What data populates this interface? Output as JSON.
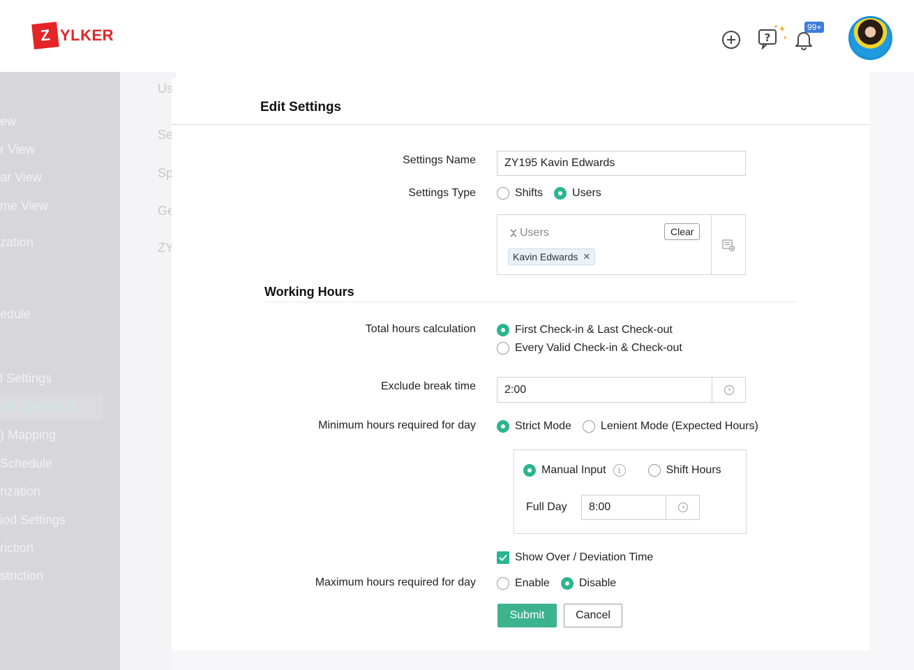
{
  "brand": {
    "logo_letter": "Z",
    "logo_rest": "YLKER",
    "accent": "#e42527"
  },
  "header": {
    "notification_badge": "99+",
    "icons": [
      "plus-circle-icon",
      "help-chat-icon",
      "bell-icon"
    ]
  },
  "sidebar": {
    "items": [
      {
        "label": "ew"
      },
      {
        "label": "r View"
      },
      {
        "label": "ar View"
      },
      {
        "label": "me View"
      },
      {
        "label": "zation"
      },
      {
        "label": "edule"
      },
      {
        "label": "l Settings"
      },
      {
        "label": "hift Specific S..."
      },
      {
        "label": ") Mapping"
      },
      {
        "label": " Schedule"
      },
      {
        "label": "rization"
      },
      {
        "label": "iod Settings"
      },
      {
        "label": "riction"
      },
      {
        "label": "striction"
      }
    ]
  },
  "midcol": {
    "items": [
      "Us",
      "Se",
      "Sp",
      "Ge",
      "ZY"
    ]
  },
  "dialog": {
    "title": "Edit Settings",
    "settings_name": {
      "label": "Settings Name",
      "value": "ZY195 Kavin Edwards"
    },
    "settings_type": {
      "label": "Settings Type",
      "options": [
        "Shifts",
        "Users"
      ],
      "selected": "Users"
    },
    "users": {
      "placeholder": "Users",
      "clear_label": "Clear",
      "chips": [
        "Kavin Edwards"
      ]
    },
    "working_hours": {
      "title": "Working Hours",
      "total_hours": {
        "label": "Total hours calculation",
        "options": [
          "First Check-in & Last Check-out",
          "Every Valid Check-in & Check-out"
        ],
        "selected": "First Check-in & Last Check-out"
      },
      "exclude_break": {
        "label": "Exclude break time",
        "value": "2:00"
      },
      "minimum_hours": {
        "label": "Minimum hours required for day",
        "options": [
          "Strict Mode",
          "Lenient Mode (Expected Hours)"
        ],
        "selected": "Strict Mode",
        "sub_options": [
          "Manual Input",
          "Shift Hours"
        ],
        "sub_selected": "Manual Input",
        "full_day_label": "Full Day",
        "full_day_value": "8:00"
      },
      "show_deviation": {
        "label": "Show Over / Deviation Time",
        "checked": true
      },
      "maximum_hours": {
        "label": "Maximum hours required for day",
        "options": [
          "Enable",
          "Disable"
        ],
        "selected": "Disable"
      }
    },
    "submit_label": "Submit",
    "cancel_label": "Cancel"
  }
}
